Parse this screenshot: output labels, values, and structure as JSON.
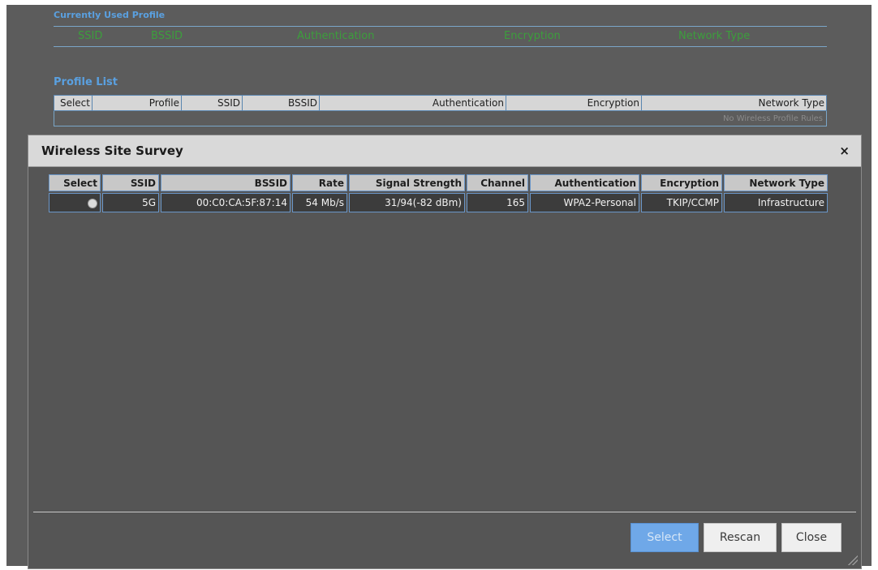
{
  "background": {
    "current_profile": {
      "title": "Currently Used Profile",
      "columns": [
        "SSID",
        "BSSID",
        "Authentication",
        "Encryption",
        "Network Type"
      ]
    },
    "profile_list": {
      "title": "Profile List",
      "columns": [
        "Select",
        "Profile",
        "SSID",
        "BSSID",
        "Authentication",
        "Encryption",
        "Network Type"
      ],
      "empty_text": "No Wireless Profile Rules"
    }
  },
  "dialog": {
    "title": "Wireless Site Survey",
    "close_glyph": "×",
    "columns": [
      "Select",
      "SSID",
      "BSSID",
      "Rate",
      "Signal Strength",
      "Channel",
      "Authentication",
      "Encryption",
      "Network Type"
    ],
    "rows": [
      {
        "ssid": "5G",
        "bssid": "00:C0:CA:5F:87:14",
        "rate": "54 Mb/s",
        "signal": "31/94(-82 dBm)",
        "channel": "165",
        "auth": "WPA2-Personal",
        "encryption": "TKIP/CCMP",
        "network_type": "Infrastructure"
      }
    ],
    "buttons": {
      "select": "Select",
      "rescan": "Rescan",
      "close": "Close"
    }
  },
  "icons": {
    "close": "close-icon",
    "radio": "radio-button",
    "resize": "resize-grip-icon"
  },
  "colors": {
    "page_bg": "#5c5c5c",
    "dialog_bg": "#555555",
    "accent_blue": "#6fa8e8",
    "header_green": "#3c9e3c",
    "section_blue": "#5aa0e0"
  }
}
